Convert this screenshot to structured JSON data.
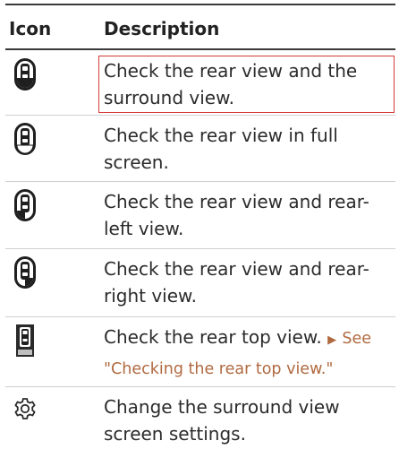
{
  "header": {
    "icon_col": "Icon",
    "desc_col": "Description"
  },
  "rows": [
    {
      "icon": "rear-surround-view-icon",
      "text": "Check the rear view and the surround view."
    },
    {
      "icon": "rear-full-screen-icon",
      "text": "Check the rear view in full screen."
    },
    {
      "icon": "rear-left-view-icon",
      "text": "Check the rear view and rear-left view."
    },
    {
      "icon": "rear-right-view-icon",
      "text": "Check the rear view and rear-right view."
    },
    {
      "icon": "rear-top-view-icon",
      "text": "Check the rear top view.",
      "see_text": "See",
      "link_text": "\"Checking the rear top view.\""
    },
    {
      "icon": "gear-icon",
      "text": "Change the surround view screen settings."
    }
  ],
  "colors": {
    "highlight": "#d33a3a",
    "link": "#b06a40"
  }
}
